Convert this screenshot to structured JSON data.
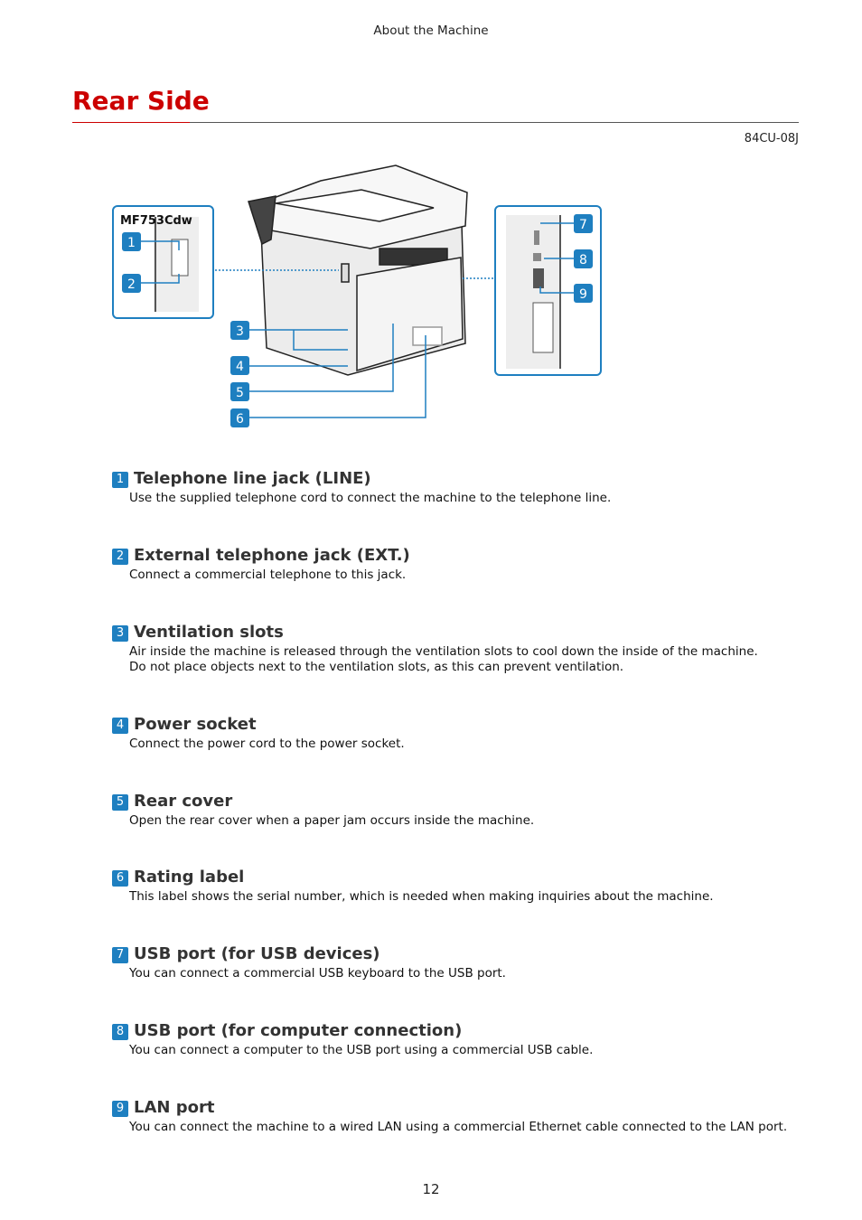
{
  "header": "About the Machine",
  "title": "Rear Side",
  "doc_code": "84CU-08J",
  "diagram": {
    "model_label": "MF753Cdw",
    "callouts": [
      "1",
      "2",
      "3",
      "4",
      "5",
      "6",
      "7",
      "8",
      "9"
    ],
    "accent": "#1e7fc0"
  },
  "items": [
    {
      "num": "1",
      "title": "Telephone line jack (LINE)",
      "desc": [
        "Use the supplied telephone cord to connect the machine to the telephone line."
      ]
    },
    {
      "num": "2",
      "title": "External telephone jack (EXT.)",
      "desc": [
        "Connect a commercial telephone to this jack."
      ]
    },
    {
      "num": "3",
      "title": "Ventilation slots",
      "desc": [
        "Air inside the machine is released through the ventilation slots to cool down the inside of the machine.",
        "Do not place objects next to the ventilation slots, as this can prevent ventilation."
      ]
    },
    {
      "num": "4",
      "title": "Power socket",
      "desc": [
        "Connect the power cord to the power socket."
      ]
    },
    {
      "num": "5",
      "title": "Rear cover",
      "desc": [
        "Open the rear cover when a paper jam occurs inside the machine."
      ]
    },
    {
      "num": "6",
      "title": "Rating label",
      "desc": [
        "This label shows the serial number, which is needed when making inquiries about the machine."
      ]
    },
    {
      "num": "7",
      "title": "USB port (for USB devices)",
      "desc": [
        "You can connect a commercial USB keyboard to the USB port."
      ]
    },
    {
      "num": "8",
      "title": "USB port (for computer connection)",
      "desc": [
        "You can connect a computer to the USB port using a commercial USB cable."
      ]
    },
    {
      "num": "9",
      "title": "LAN port",
      "desc": [
        "You can connect the machine to a wired LAN using a commercial Ethernet cable connected to the LAN port."
      ]
    }
  ],
  "page_number": "12"
}
